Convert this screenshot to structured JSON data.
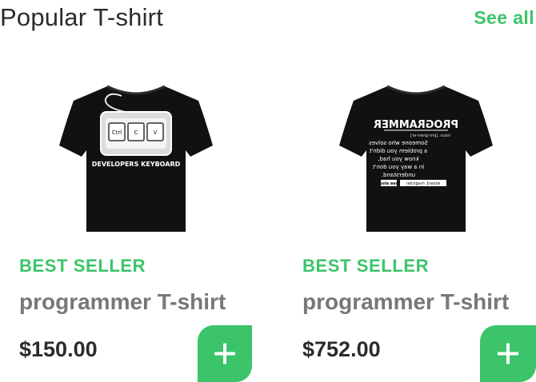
{
  "header": {
    "title": "Popular T-shirt",
    "see_all": "See all"
  },
  "products": [
    {
      "badge": "BEST SELLER",
      "name": "programmer T-shirt",
      "price": "$150.00",
      "image": "developers-keyboard-tshirt",
      "print": {
        "keys": [
          "Ctrl",
          "C",
          "V"
        ],
        "caption": "DEVELOPERS KEYBOARD"
      }
    },
    {
      "badge": "BEST SELLER",
      "name": "programmer T-shirt",
      "price": "$752.00",
      "image": "programmer-definition-tshirt",
      "print": {
        "heading": "PROGRAMMER",
        "pronunciation": "noun. [pro-gram-er]",
        "lines": [
          "Someone who solves",
          "a problem you didn't",
          "know you had,",
          "in a way you don't",
          "understand."
        ],
        "see_also": "see also",
        "related": "wizard, magician"
      }
    }
  ],
  "colors": {
    "accent": "#3cc46a",
    "title": "#2b2b2b",
    "name": "#777777",
    "shirt": "#111111"
  }
}
